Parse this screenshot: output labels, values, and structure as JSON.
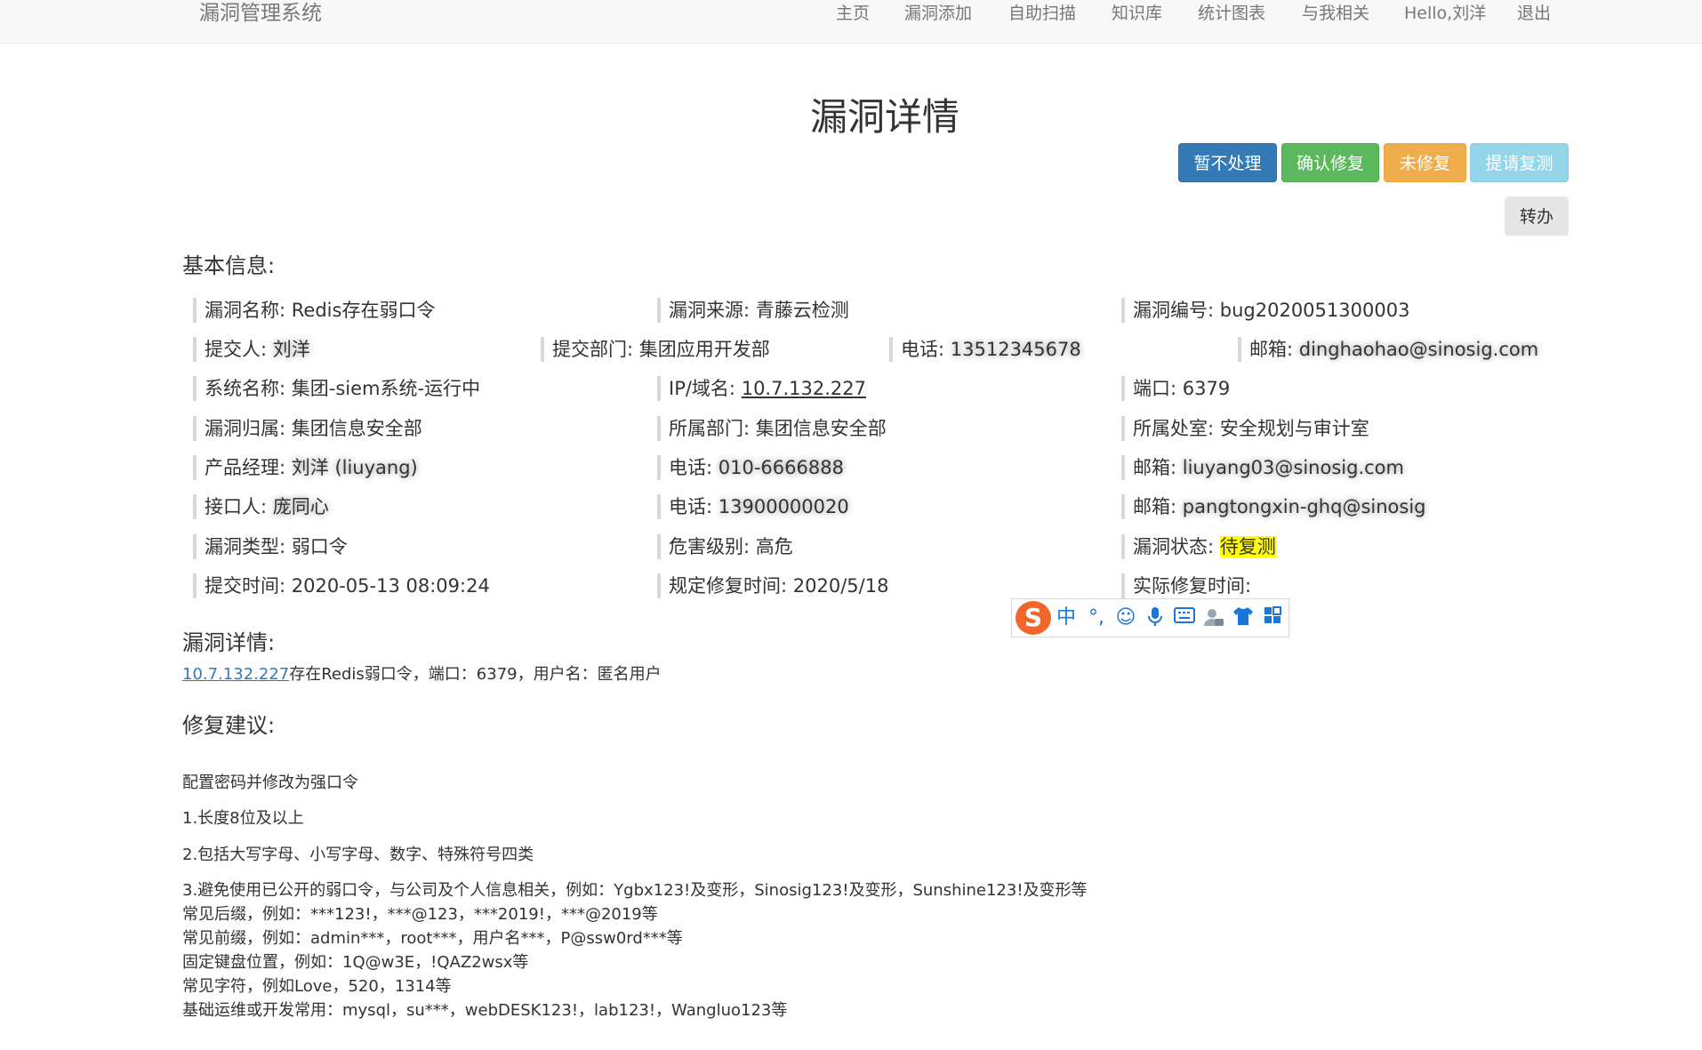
{
  "navbar": {
    "brand": "漏洞管理系统",
    "items": [
      "主页",
      "漏洞添加",
      "自助扫描",
      "知识库",
      "统计图表",
      "与我相关",
      "Hello,刘洋",
      "退出"
    ]
  },
  "page_title": "漏洞详情",
  "actions": {
    "hold": "暂不处理",
    "confirm": "确认修复",
    "unfixed": "未修复",
    "retest": "提请复测",
    "transfer": "转办"
  },
  "sections": {
    "basic": "基本信息:",
    "detail": "漏洞详情:",
    "advice": "修复建议:"
  },
  "fields": {
    "name_label": "漏洞名称:",
    "name": "Redis存在弱口令",
    "source_label": "漏洞来源:",
    "source": "青藤云检测",
    "id_label": "漏洞编号:",
    "id": "bug2020051300003",
    "submitter_label": "提交人:",
    "submitter": "刘洋",
    "submit_dept_label": "提交部门:",
    "submit_dept": "集团应用开发部",
    "submit_phone_label": "电话:",
    "submit_phone": "13512345678",
    "submit_email_label": "邮箱:",
    "submit_email": "dinghaohao@sinosig.com",
    "system_label": "系统名称:",
    "system": "集团-siem系统-运行中",
    "ip_label": "IP/域名:",
    "ip": "10.7.132.227",
    "port_label": "端口:",
    "port": "6379",
    "owner_label": "漏洞归属:",
    "owner": "集团信息安全部",
    "dept_label": "所属部门:",
    "dept": "集团信息安全部",
    "office_label": "所属处室:",
    "office": "安全规划与审计室",
    "pm_label": "产品经理:",
    "pm": "刘洋 (liuyang)",
    "pm_phone_label": "电话:",
    "pm_phone": "010-6666888",
    "pm_email_label": "邮箱:",
    "pm_email": "liuyang03@sinosig.com",
    "contact_label": "接口人:",
    "contact": "庞同心",
    "contact_phone_label": "电话:",
    "contact_phone": "13900000020",
    "contact_email_label": "邮箱:",
    "contact_email": "pangtongxin-ghq@sinosig",
    "type_label": "漏洞类型:",
    "type": "弱口令",
    "level_label": "危害级别:",
    "level": "高危",
    "status_label": "漏洞状态:",
    "status": "待复测",
    "submit_time_label": "提交时间:",
    "submit_time": "2020-05-13 08:09:24",
    "due_label": "规定修复时间:",
    "due": "2020/5/18",
    "actual_label": "实际修复时间:",
    "actual": ""
  },
  "detail": {
    "ip": "10.7.132.227",
    "text": "存在Redis弱口令，端口：6379，用户名：匿名用户"
  },
  "advice": [
    "配置密码并修改为强口令",
    "1.长度8位及以上",
    "2.包括大写字母、小写字母、数字、特殊符号四类",
    "3.避免使用已公开的弱口令，与公司及个人信息相关，例如：Ygbx123!及变形，Sinosig123!及变形，Sunshine123!及变形等",
    "常见后缀，例如：***123!，***@123，***2019!，***@2019等",
    "常见前缀，例如：admin***，root***，用户名***，P@ssw0rd***等",
    "固定键盘位置，例如：1Q@w3E，!QAZ2wsx等",
    "常见字符，例如Love，520，1314等",
    "基础运维或开发常用：mysql，su***，webDESK123!，lab123!，Wangluo123等"
  ],
  "ime": {
    "logo": "S",
    "lang": "中",
    "punct": "°,",
    "emoji": "☺",
    "mic": "🎤",
    "keyboard": "⌨",
    "skin": "👕",
    "apps": "▦"
  }
}
